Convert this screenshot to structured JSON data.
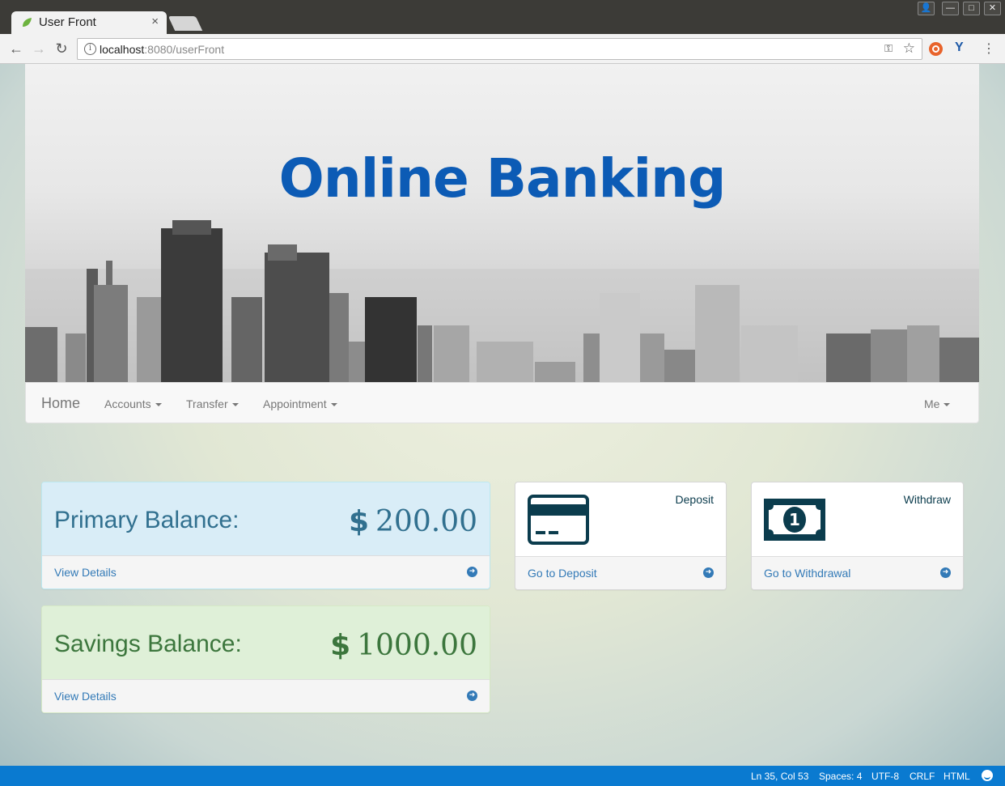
{
  "browser": {
    "tab_title": "User Front",
    "tab_close": "×",
    "url_host": "localhost",
    "url_rest": ":8080/userFront"
  },
  "page": {
    "hero_title": "Online Banking",
    "nav": {
      "brand": "Home",
      "items": [
        "Accounts",
        "Transfer",
        "Appointment"
      ],
      "right_item": "Me"
    },
    "primary": {
      "label": "Primary Balance:",
      "currency": "$",
      "amount": "200.00",
      "link": "View Details"
    },
    "savings": {
      "label": "Savings Balance:",
      "currency": "$",
      "amount": "1000.00",
      "link": "View Details"
    },
    "deposit": {
      "title": "Deposit",
      "link": "Go to Deposit",
      "icon": "credit-card-icon"
    },
    "withdraw": {
      "title": "Withdraw",
      "link": "Go to Withdrawal",
      "icon": "money-bill-icon"
    }
  },
  "statusbar": {
    "position": "Ln 35, Col 53",
    "spaces": "Spaces: 4",
    "encoding": "UTF-8",
    "line_ending": "CRLF",
    "language": "HTML"
  },
  "colors": {
    "brand_blue": "#0c5bb5",
    "link_blue": "#337ab7",
    "info_bg": "#d9edf7",
    "success_bg": "#dff0d8",
    "icon_dark": "#0b3c4d",
    "statusbar": "#0a7ad0"
  }
}
